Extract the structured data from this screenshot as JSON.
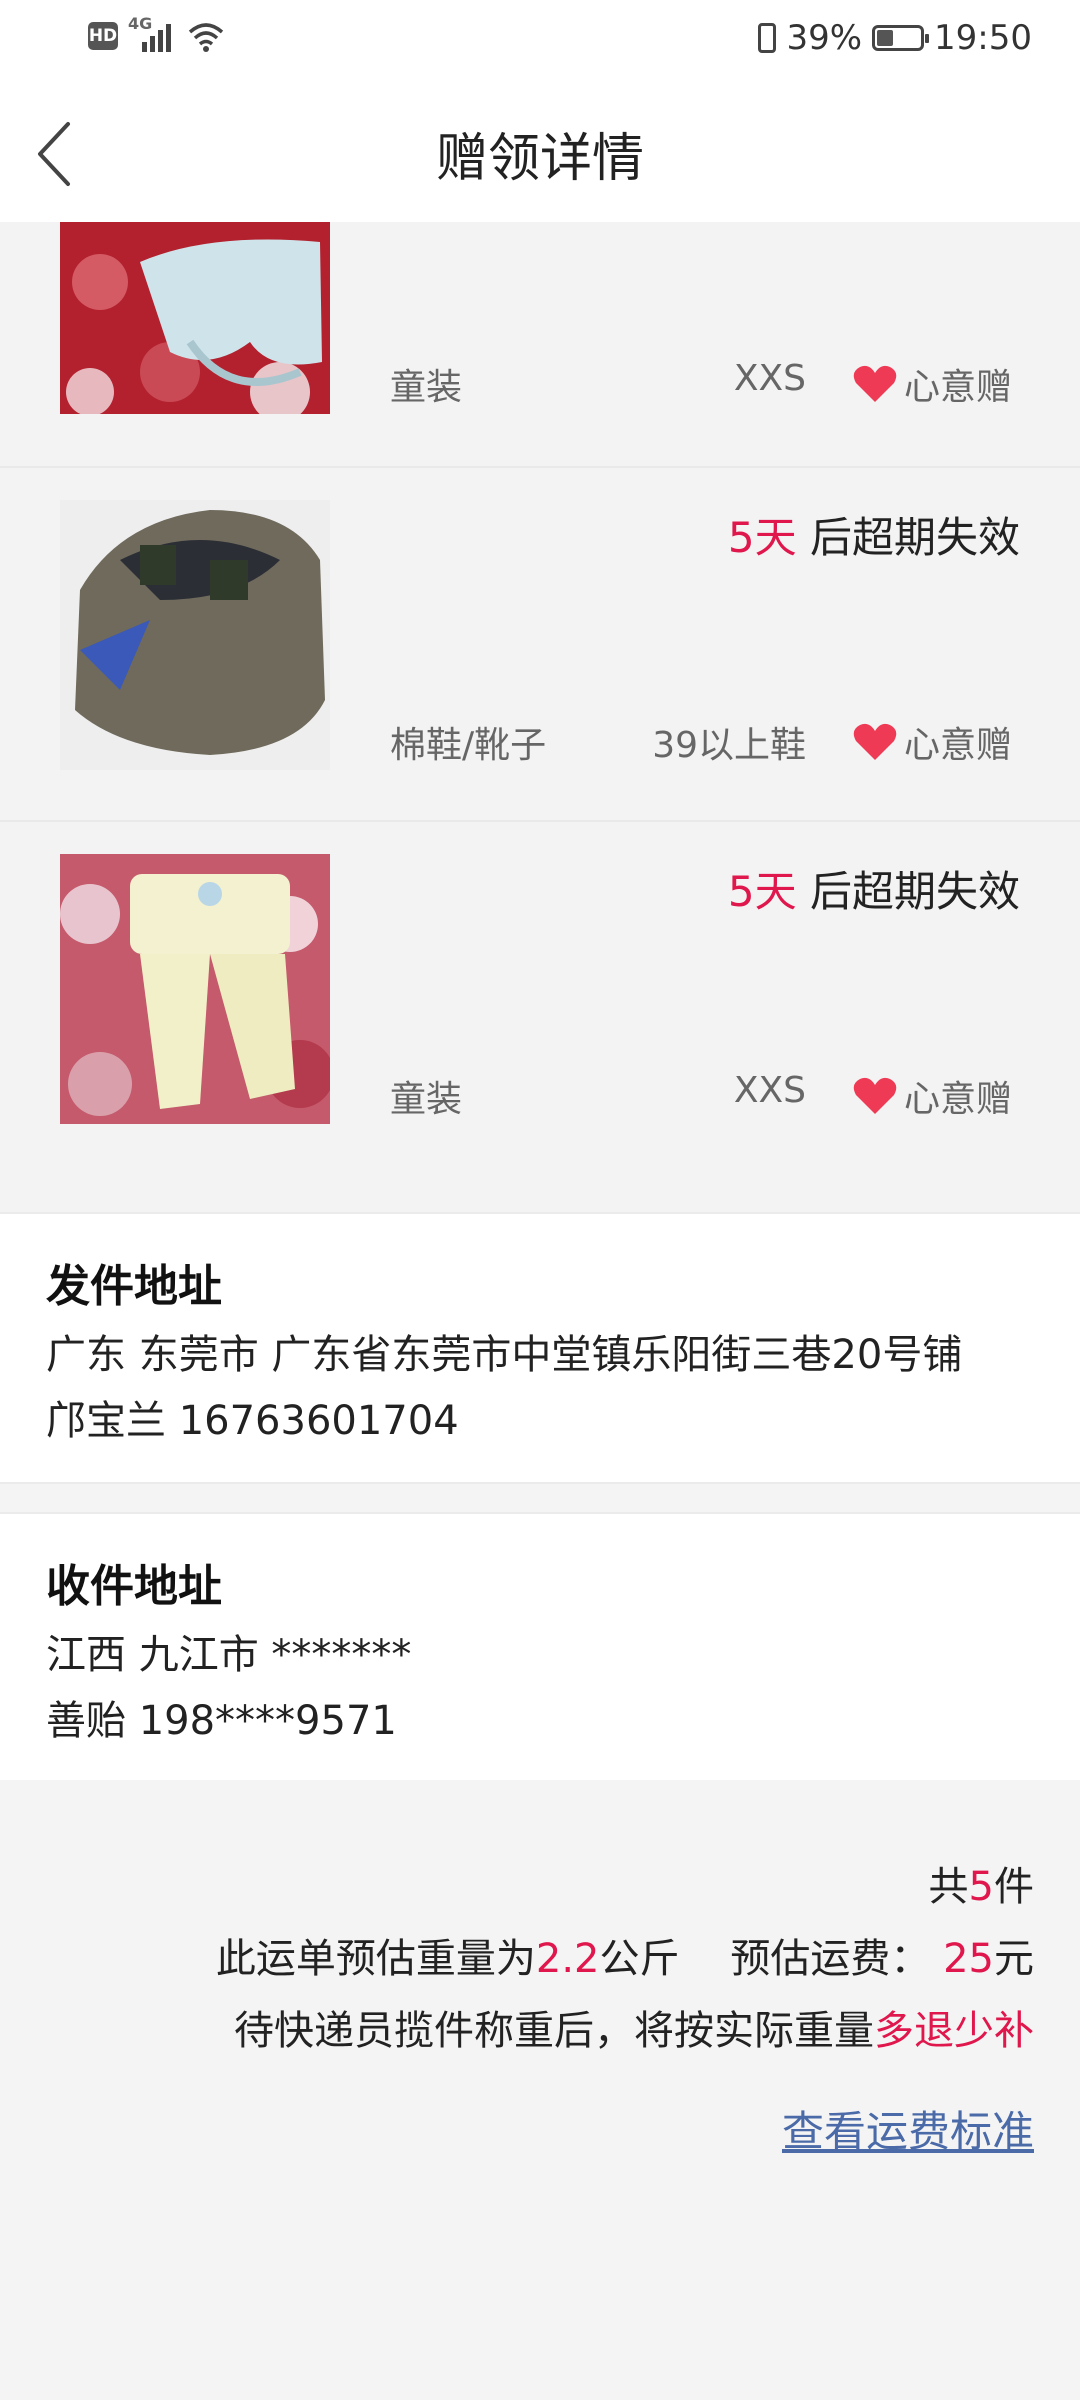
{
  "status": {
    "hd": "HD",
    "network": "4G",
    "battery_text": "39%",
    "battery_level": 0.39,
    "time": "19:50"
  },
  "header": {
    "title": "赠领详情"
  },
  "items": [
    {
      "category": "童装",
      "size": "XXS",
      "tag": "心意赠",
      "image": "children-clothes-photo"
    },
    {
      "expire_days": "5天",
      "expire_suffix": " 后超期失效",
      "category": "棉鞋/靴子",
      "size": "39以上鞋",
      "tag": "心意赠",
      "image": "shoe-photo"
    },
    {
      "expire_days": "5天",
      "expire_suffix": " 后超期失效",
      "category": "童装",
      "size": "XXS",
      "tag": "心意赠",
      "image": "children-clothes-photo"
    }
  ],
  "sender": {
    "heading": "发件地址",
    "line1": "广东 东莞市 广东省东莞市中堂镇乐阳街三巷20号铺",
    "line2": "邝宝兰 16763601704"
  },
  "receiver": {
    "heading": "收件地址",
    "line1": "江西 九江市 *******",
    "line2": "善贻 198****9571"
  },
  "summary": {
    "count_prefix": "共",
    "count": "5",
    "count_suffix": "件",
    "weight_prefix": "此运单预估重量为",
    "weight": "2.2",
    "weight_unit": "公斤",
    "fee_label": "预估运费：",
    "fee": "25",
    "fee_unit": "元",
    "note_prefix": "待快递员揽件称重后，将按实际重量",
    "note_highlight": "多退少补",
    "link": "查看运费标准"
  },
  "colors": {
    "accent": "#e0174c",
    "link": "#4a6aa8",
    "heart": "#ef3a55"
  }
}
